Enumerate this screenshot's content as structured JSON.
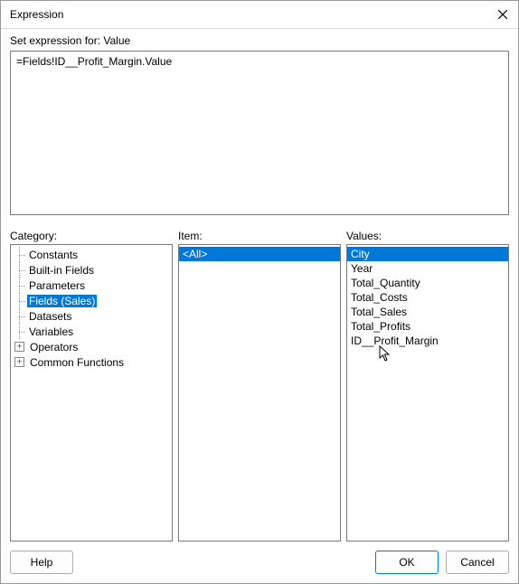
{
  "window": {
    "title": "Expression"
  },
  "setFor": {
    "label": "Set expression for: Value"
  },
  "expression": {
    "value": "=Fields!ID__Profit_Margin.Value"
  },
  "columns": {
    "category": {
      "label": "Category:",
      "items": [
        {
          "label": "Constants",
          "expandable": false
        },
        {
          "label": "Built-in Fields",
          "expandable": false
        },
        {
          "label": "Parameters",
          "expandable": false
        },
        {
          "label": "Fields (Sales)",
          "expandable": false,
          "selected": true
        },
        {
          "label": "Datasets",
          "expandable": false
        },
        {
          "label": "Variables",
          "expandable": false
        },
        {
          "label": "Operators",
          "expandable": true
        },
        {
          "label": "Common Functions",
          "expandable": true
        }
      ]
    },
    "item": {
      "label": "Item:",
      "items": [
        {
          "label": "<All>",
          "selected": true
        }
      ]
    },
    "values": {
      "label": "Values:",
      "items": [
        {
          "label": "City",
          "selected": true
        },
        {
          "label": "Year"
        },
        {
          "label": "Total_Quantity"
        },
        {
          "label": "Total_Costs"
        },
        {
          "label": "Total_Sales"
        },
        {
          "label": "Total_Profits"
        },
        {
          "label": "ID__Profit_Margin"
        }
      ]
    }
  },
  "footer": {
    "help": "Help",
    "ok": "OK",
    "cancel": "Cancel"
  }
}
